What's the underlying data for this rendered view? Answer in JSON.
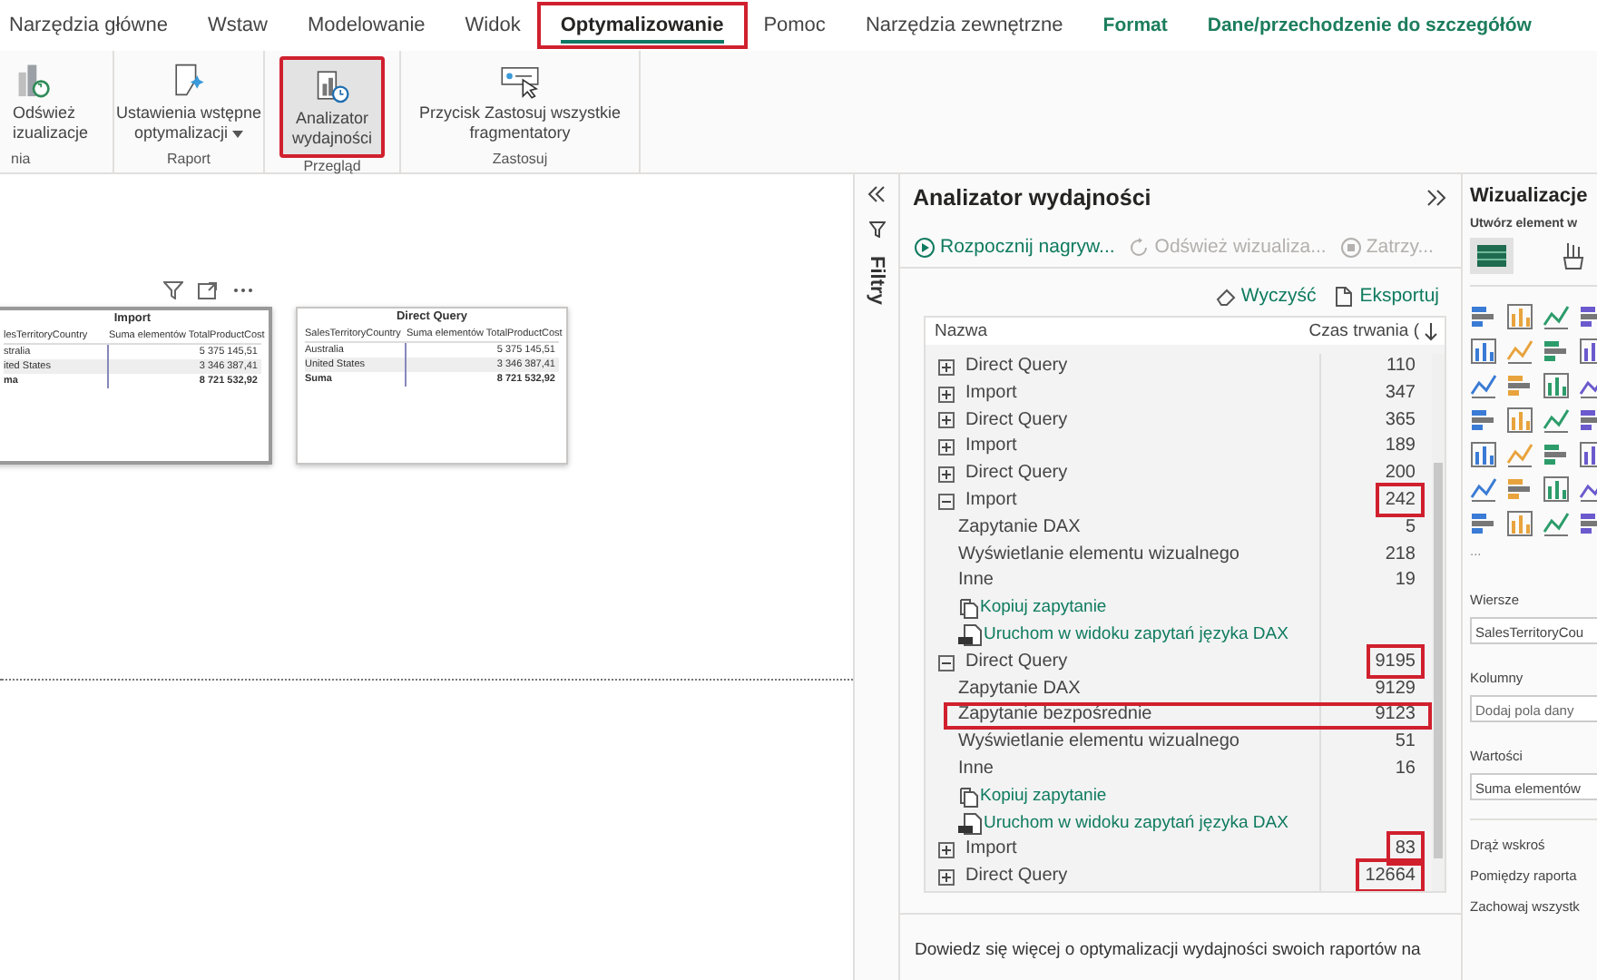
{
  "tabs": [
    {
      "label": "Narzędzia główne",
      "selected": false,
      "contextual": false,
      "highlighted": false
    },
    {
      "label": "Wstaw",
      "selected": false,
      "contextual": false,
      "highlighted": false
    },
    {
      "label": "Modelowanie",
      "selected": false,
      "contextual": false,
      "highlighted": false
    },
    {
      "label": "Widok",
      "selected": false,
      "contextual": false,
      "highlighted": false
    },
    {
      "label": "Optymalizowanie",
      "selected": true,
      "contextual": false,
      "highlighted": true
    },
    {
      "label": "Pomoc",
      "selected": false,
      "contextual": false,
      "highlighted": false
    },
    {
      "label": "Narzędzia zewnętrzne",
      "selected": false,
      "contextual": false,
      "highlighted": false
    },
    {
      "label": "Format",
      "selected": false,
      "contextual": true,
      "highlighted": false
    },
    {
      "label": "Dane/przechodzenie do szczegółów",
      "selected": false,
      "contextual": true,
      "highlighted": false
    }
  ],
  "ribbon": {
    "groups": [
      {
        "label": "nia",
        "buttons": [
          {
            "lines": [
              "Odśwież",
              "izualizacje"
            ],
            "pressed": false,
            "dropdown": false,
            "highlighted": false
          }
        ]
      },
      {
        "label": "Raport",
        "buttons": [
          {
            "lines": [
              "Ustawienia wstępne",
              "optymalizacji"
            ],
            "pressed": false,
            "dropdown": true,
            "highlighted": false
          }
        ]
      },
      {
        "label": "Przegląd",
        "buttons": [
          {
            "lines": [
              "Analizator",
              "wydajności"
            ],
            "pressed": true,
            "dropdown": false,
            "highlighted": true
          }
        ]
      },
      {
        "label": "Zastosuj",
        "buttons": [
          {
            "lines": [
              "Przycisk Zastosuj wszystkie",
              "fragmentatory"
            ],
            "pressed": false,
            "dropdown": false,
            "highlighted": false
          }
        ]
      }
    ]
  },
  "canvas": {
    "visuals": [
      {
        "title": "Import",
        "focused": true,
        "columns": [
          "lesTerritoryCountry",
          "Suma elementów TotalProductCost"
        ],
        "rows": [
          [
            "stralia",
            "5 375 145,51"
          ],
          [
            "ited States",
            "3 346 387,41"
          ]
        ],
        "total": [
          "ma",
          "8 721 532,92"
        ]
      },
      {
        "title": "Direct Query",
        "focused": false,
        "columns": [
          "SalesTerritoryCountry",
          "Suma elementów TotalProductCost"
        ],
        "rows": [
          [
            "Australia",
            "5 375 145,51"
          ],
          [
            "United States",
            "3 346 387,41"
          ]
        ],
        "total": [
          "Suma",
          "8 721 532,92"
        ]
      }
    ]
  },
  "filters": {
    "title": "Filtry"
  },
  "perf": {
    "title": "Analizator wydajności",
    "actions": [
      {
        "label": "Rozpocznij nagryw...",
        "disabled": false
      },
      {
        "label": "Odśwież wizualiza...",
        "disabled": true
      },
      {
        "label": "Zatrzy...",
        "disabled": true
      }
    ],
    "tools": [
      "Wyczyść",
      "Eksportuj"
    ],
    "columns": [
      "Nazwa",
      "Czas trwania ("
    ],
    "rows": [
      {
        "name": "Direct Query",
        "duration": "110",
        "expanded": false,
        "highlighted": false
      },
      {
        "name": "Import",
        "duration": "347",
        "expanded": false,
        "highlighted": false
      },
      {
        "name": "Direct Query",
        "duration": "365",
        "expanded": false,
        "highlighted": false
      },
      {
        "name": "Import",
        "duration": "189",
        "expanded": false,
        "highlighted": false
      },
      {
        "name": "Direct Query",
        "duration": "200",
        "expanded": false,
        "highlighted": false
      },
      {
        "name": "Import",
        "duration": "242",
        "expanded": true,
        "highlighted": true,
        "children": [
          {
            "kind": "metric",
            "name": "Zapytanie DAX",
            "duration": "5",
            "highlighted": false
          },
          {
            "kind": "metric",
            "name": "Wyświetlanie elementu wizualnego",
            "duration": "218",
            "highlighted": false
          },
          {
            "kind": "metric",
            "name": "Inne",
            "duration": "19",
            "highlighted": false
          },
          {
            "kind": "copy-link",
            "name": "Kopiuj zapytanie"
          },
          {
            "kind": "dax-link",
            "name": "Uruchom w widoku zapytań języka DAX"
          }
        ]
      },
      {
        "name": "Direct Query",
        "duration": "9195",
        "expanded": true,
        "highlighted": true,
        "children": [
          {
            "kind": "metric",
            "name": "Zapytanie DAX",
            "duration": "9129",
            "highlighted": false
          },
          {
            "kind": "metric",
            "name": "Zapytanie bezpośrednie",
            "duration": "9123",
            "highlighted": true
          },
          {
            "kind": "metric",
            "name": "Wyświetlanie elementu wizualnego",
            "duration": "51",
            "highlighted": false
          },
          {
            "kind": "metric",
            "name": "Inne",
            "duration": "16",
            "highlighted": false
          },
          {
            "kind": "copy-link",
            "name": "Kopiuj zapytanie"
          },
          {
            "kind": "dax-link",
            "name": "Uruchom w widoku zapytań języka DAX"
          }
        ]
      },
      {
        "name": "Import",
        "duration": "83",
        "expanded": false,
        "highlighted": true
      },
      {
        "name": "Direct Query",
        "duration": "12664",
        "expanded": false,
        "highlighted": true
      }
    ],
    "footer": "Dowiedz się więcej o optymalizacji wydajności swoich raportów na"
  },
  "viz": {
    "title": "Wizualizacje",
    "subtitle": "Utwórz element w",
    "more": "...",
    "wells": [
      {
        "label": "Wiersze",
        "value": "SalesTerritoryCou"
      },
      {
        "label": "Kolumny",
        "placeholder": "Dodaj pola dany"
      },
      {
        "label": "Wartości",
        "value": "Suma elementów"
      }
    ],
    "drill_title": "Drąż wskroś",
    "drill_items": [
      "Pomiędzy raporta",
      "Zachowaj wszystk"
    ]
  }
}
